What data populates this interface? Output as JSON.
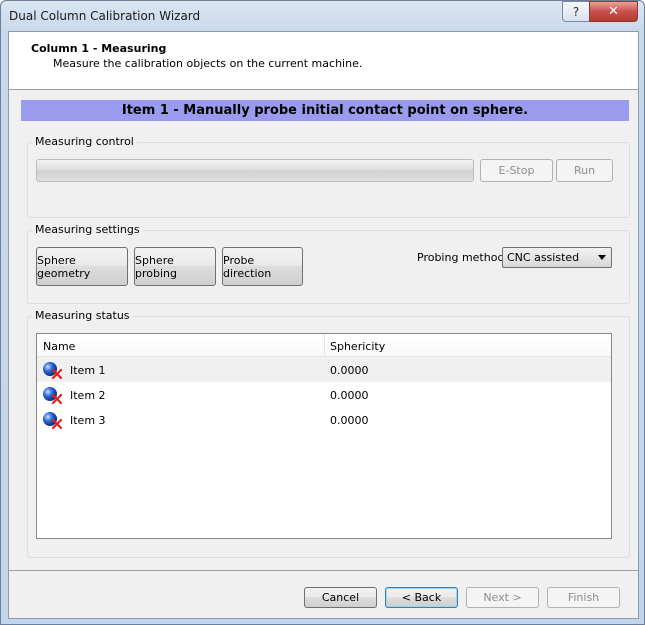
{
  "window": {
    "title": "Dual Column Calibration Wizard",
    "help_label": "?",
    "close_label": "✕"
  },
  "header": {
    "title": "Column 1 - Measuring",
    "subtitle": "Measure the calibration objects on the current machine."
  },
  "banner": "Item 1 - Manually probe initial contact point on sphere.",
  "measuring_control": {
    "label": "Measuring control",
    "progress": 0,
    "estop_label": "E-Stop",
    "run_label": "Run"
  },
  "measuring_settings": {
    "label": "Measuring settings",
    "sphere_geometry_label": "Sphere geometry",
    "sphere_probing_label": "Sphere probing",
    "probe_direction_label": "Probe direction",
    "probing_method_label": "Probing method:",
    "probing_method_value": "CNC assisted"
  },
  "measuring_status": {
    "label": "Measuring status",
    "columns": [
      "Name",
      "Sphericity"
    ],
    "rows": [
      {
        "name": "Item 1",
        "sphericity": "0.0000"
      },
      {
        "name": "Item 2",
        "sphericity": "0.0000"
      },
      {
        "name": "Item 3",
        "sphericity": "0.0000"
      }
    ]
  },
  "footer": {
    "cancel_label": "Cancel",
    "back_label": "< Back",
    "next_label": "Next >",
    "finish_label": "Finish"
  },
  "colors": {
    "banner": "#9a9aef",
    "sphere": "#2f6fe0",
    "error_x": "#e02020"
  },
  "icons": {
    "row_icon": "sphere-error-icon"
  }
}
